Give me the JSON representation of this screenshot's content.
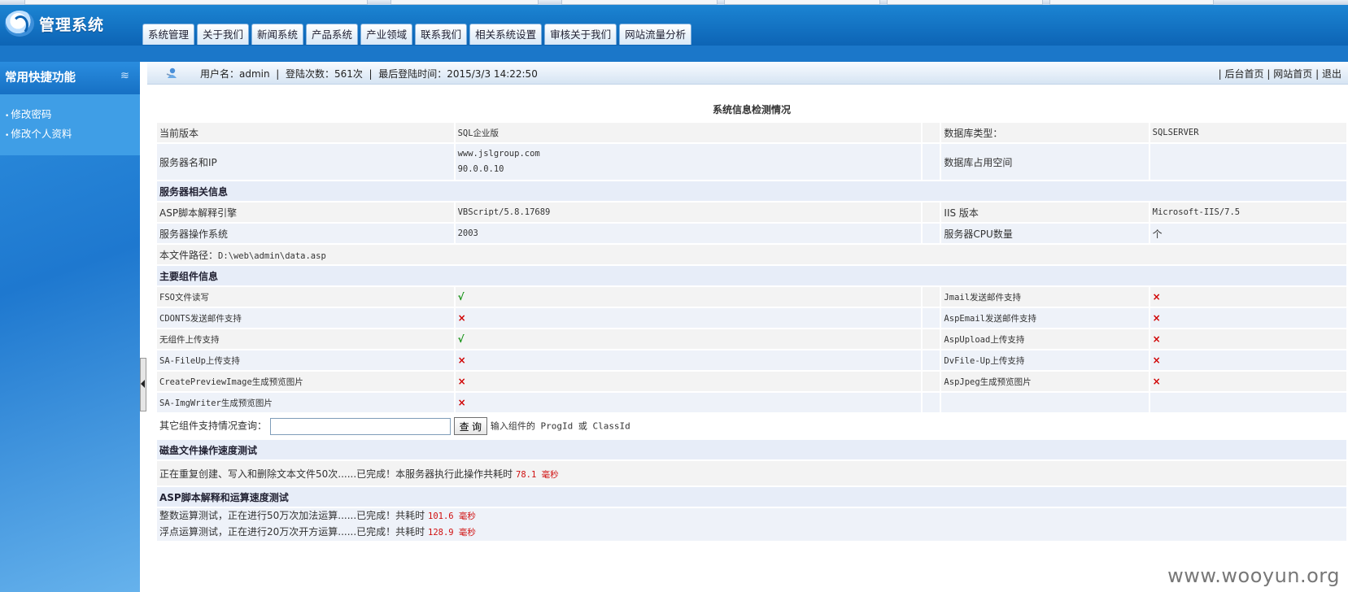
{
  "header": {
    "logo_text": "管理系统",
    "nav_tabs": [
      "系统管理",
      "关于我们",
      "新闻系统",
      "产品系统",
      "产业领域",
      "联系我们",
      "相关系统设置",
      "审核关于我们",
      "网站流量分析"
    ]
  },
  "sidebar": {
    "title": "常用快捷功能",
    "collapse_glyph": "≋",
    "links": [
      "修改密码",
      "修改个人资料"
    ]
  },
  "infobar": {
    "user_label": "用户名：",
    "user": "admin",
    "sep": "|",
    "login_count_label": "登陆次数：",
    "login_count": "561次",
    "last_login_label": "最后登陆时间：",
    "last_login": "2015/3/3 14:22:50",
    "links": [
      "后台首页",
      "网站首页",
      "退出"
    ]
  },
  "sysinfo": {
    "title": "系统信息检测情况",
    "version_label": "当前版本",
    "version": "SQL企业版",
    "db_type_label": "数据库类型：",
    "db_type": "SQLSERVER",
    "server_label": "服务器名和IP",
    "server_name": "www.jslgroup.com",
    "server_ip": "90.0.0.10",
    "db_space_label": "数据库占用空间",
    "server_section": "服务器相关信息",
    "asp_engine_label": "ASP脚本解释引擎",
    "asp_engine": "VBScript/5.8.17689",
    "iis_label": "IIS 版本",
    "iis": "Microsoft-IIS/7.5",
    "os_label": "服务器操作系统",
    "os": "2003",
    "cpu_label": "服务器CPU数量",
    "cpu": "个",
    "path_label": "本文件路径：",
    "path": "D:\\web\\admin\\data.asp",
    "component_section": "主要组件信息",
    "components": [
      {
        "left_label": "FSO文件读写",
        "left_ok": true,
        "left_mark": "√",
        "right_label": "Jmail发送邮件支持",
        "right_mark": "×"
      },
      {
        "left_label": "CDONTS发送邮件支持",
        "left_ok": false,
        "left_mark": "×",
        "right_label": "AspEmail发送邮件支持",
        "right_mark": "×"
      },
      {
        "left_label": "无组件上传支持",
        "left_ok": true,
        "left_mark": "√",
        "right_label": "AspUpload上传支持",
        "right_mark": "×"
      },
      {
        "left_label": "SA-FileUp上传支持",
        "left_ok": false,
        "left_mark": "×",
        "right_label": "DvFile-Up上传支持",
        "right_mark": "×"
      },
      {
        "left_label": "CreatePreviewImage生成预览图片",
        "left_ok": false,
        "left_mark": "×",
        "right_label": "AspJpeg生成预览图片",
        "right_mark": "×"
      },
      {
        "left_label": "SA-ImgWriter生成预览图片",
        "left_ok": false,
        "left_mark": "×",
        "right_label": "",
        "right_mark": ""
      }
    ],
    "query_label": "其它组件支持情况查询：",
    "query_value": "",
    "query_button": "查 询",
    "query_hint": "输入组件的 ProgId 或 ClassId",
    "disk_section": "磁盘文件操作速度测试",
    "disk_text": "正在重复创建、写入和删除文本文件50次......已完成！本服务器执行此操作共耗时",
    "disk_time": "78.1 毫秒",
    "asp_section": "ASP脚本解释和运算速度测试",
    "int_text": "整数运算测试，正在进行50万次加法运算......已完成！共耗时",
    "int_time": "101.6 毫秒",
    "float_text": "浮点运算测试，正在进行20万次开方运算......已完成！共耗时",
    "float_time": "128.9 毫秒"
  },
  "watermark": "www.wooyun.org"
}
